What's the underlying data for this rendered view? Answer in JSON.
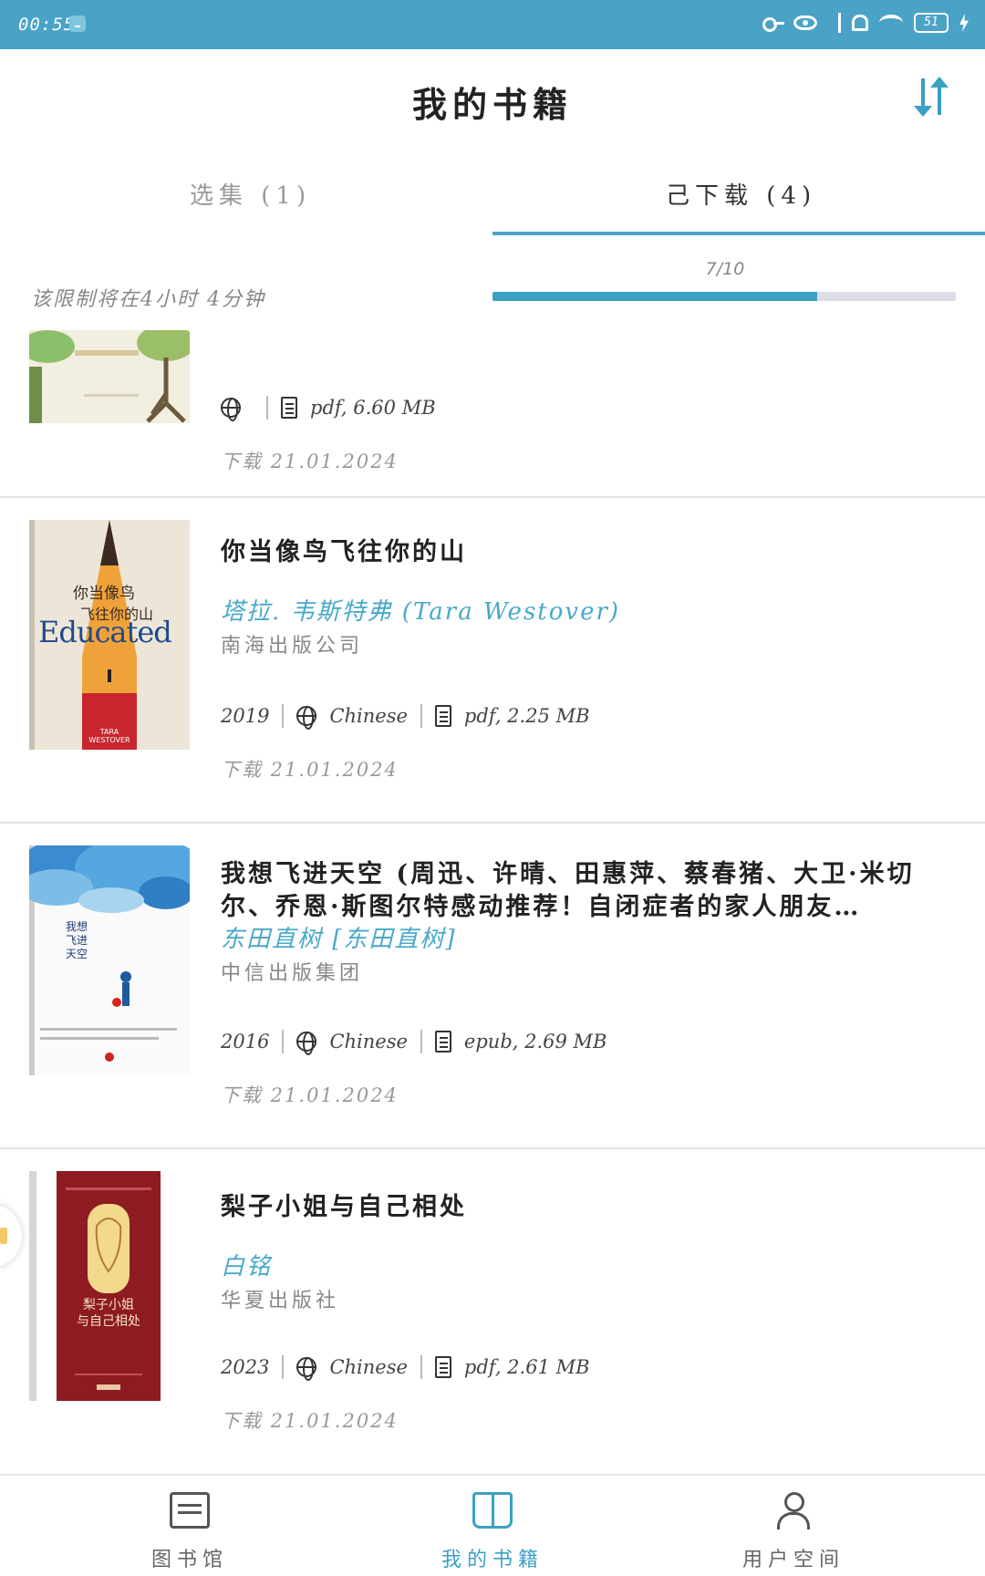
{
  "status_bar": {
    "time": "00:55",
    "battery": "51"
  },
  "header": {
    "title": "我的书籍"
  },
  "tabs": [
    {
      "label": "选集 (1)"
    },
    {
      "label": "己下载 (4)"
    }
  ],
  "limit_text": "该限制将在4小时 4分钟",
  "progress": {
    "label": "7/10",
    "value": 0.7
  },
  "books": [
    {
      "title": "",
      "author": "",
      "publisher": "",
      "year": "",
      "language": "",
      "file": "pdf, 6.60 MB",
      "download_date": "下载 21.01.2024"
    },
    {
      "title": "你当像鸟飞往你的山",
      "author": "塔拉. 韦斯特弗 (Tara Westover)",
      "publisher": "南海出版公司",
      "year": "2019",
      "language": "Chinese",
      "file": "pdf, 2.25 MB",
      "download_date": "下载 21.01.2024",
      "cover_text": {
        "line1": "你当像鸟",
        "line2": "飞往你的山",
        "big": "Educated",
        "small": "TARA WESTOVER"
      }
    },
    {
      "title": "我想飞进天空 (周迅、许晴、田惠萍、蔡春猪、大卫·米切尔、乔恩·斯图尔特感动推荐！自闭症者的家人朋友…",
      "author": "东田直树 [东田直树]",
      "publisher": "中信出版集团",
      "year": "2016",
      "language": "Chinese",
      "file": "epub, 2.69 MB",
      "download_date": "下载 21.01.2024",
      "cover_text": {
        "vertical": "我想飞进天空"
      }
    },
    {
      "title": "梨子小姐与自己相处",
      "author": "白铭",
      "publisher": "华夏出版社",
      "year": "2023",
      "language": "Chinese",
      "file": "pdf, 2.61 MB",
      "download_date": "下载 21.01.2024",
      "cover_text": {
        "line1": "梨子小姐",
        "line2": "与自己相处"
      }
    }
  ],
  "bottom_nav": [
    {
      "label": "图书馆",
      "icon": "library-icon"
    },
    {
      "label": "我的书籍",
      "icon": "book-icon"
    },
    {
      "label": "用户空间",
      "icon": "user-icon"
    }
  ],
  "colors": {
    "accent": "#3aa0c4",
    "status_bar": "#4aa3c7",
    "author": "#49a8c9"
  }
}
